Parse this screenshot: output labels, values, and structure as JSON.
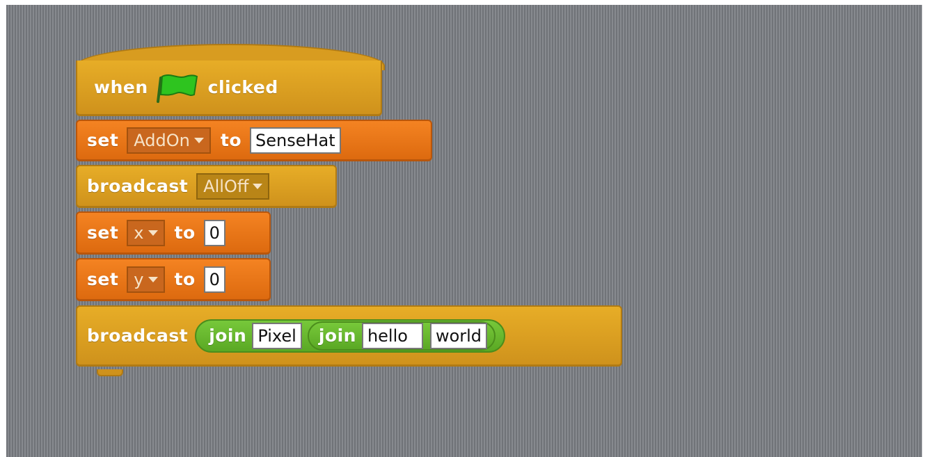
{
  "script": {
    "hat": {
      "when": "when",
      "clicked": "clicked",
      "icon": "green-flag-icon"
    },
    "set_addon": {
      "set": "set",
      "variable": "AddOn",
      "to": "to",
      "value": "SenseHat"
    },
    "broadcast_alloff": {
      "label": "broadcast",
      "message": "AllOff"
    },
    "set_x": {
      "set": "set",
      "variable": "x",
      "to": "to",
      "value": "0"
    },
    "set_y": {
      "set": "set",
      "variable": "y",
      "to": "to",
      "value": "0"
    },
    "broadcast_join": {
      "label": "broadcast",
      "join1": {
        "label": "join",
        "value": "Pixel"
      },
      "join2": {
        "label": "join",
        "value1": "hello",
        "value2": "world"
      }
    }
  },
  "colors": {
    "events": "#e0a224",
    "data": "#ef7a1b",
    "operators": "#66b82e",
    "canvas": "#7a7d82"
  }
}
